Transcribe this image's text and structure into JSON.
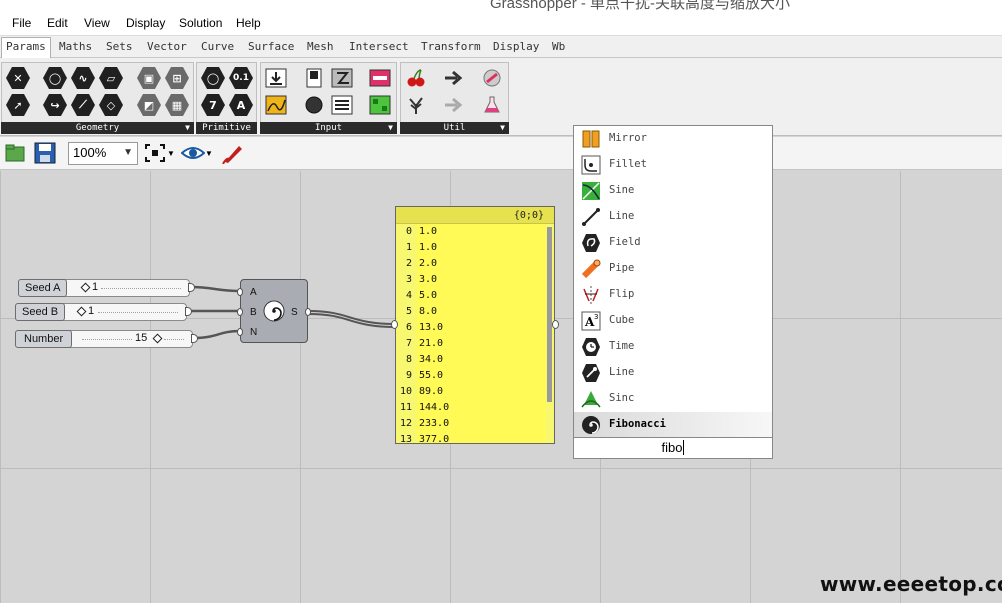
{
  "window": {
    "title": "Grasshopper - 单点干扰-关联高度与缩放大小"
  },
  "menu": [
    "File",
    "Edit",
    "View",
    "Display",
    "Solution",
    "Help"
  ],
  "tabs": [
    "Params",
    "Maths",
    "Sets",
    "Vector",
    "Curve",
    "Surface",
    "Mesh",
    "Intersect",
    "Transform",
    "Display",
    "Wb"
  ],
  "ribbon": {
    "panels": [
      "Geometry",
      "Primitive",
      "Input",
      "Util"
    ],
    "primitive_glyphs": [
      "0.1",
      "7",
      "A"
    ]
  },
  "toolbar": {
    "zoom": "100%"
  },
  "sliders": [
    {
      "name": "Seed A",
      "value": "1"
    },
    {
      "name": "Seed B",
      "value": "1"
    },
    {
      "name": "Number",
      "value": "15"
    }
  ],
  "fibonacci_component": {
    "inputs": [
      "A",
      "B",
      "N"
    ],
    "output": "S"
  },
  "panel": {
    "path": "{0;0}",
    "rows": [
      {
        "i": "0",
        "v": "1.0"
      },
      {
        "i": "1",
        "v": "1.0"
      },
      {
        "i": "2",
        "v": "2.0"
      },
      {
        "i": "3",
        "v": "3.0"
      },
      {
        "i": "4",
        "v": "5.0"
      },
      {
        "i": "5",
        "v": "8.0"
      },
      {
        "i": "6",
        "v": "13.0"
      },
      {
        "i": "7",
        "v": "21.0"
      },
      {
        "i": "8",
        "v": "34.0"
      },
      {
        "i": "9",
        "v": "55.0"
      },
      {
        "i": "10",
        "v": "89.0"
      },
      {
        "i": "11",
        "v": "144.0"
      },
      {
        "i": "12",
        "v": "233.0"
      },
      {
        "i": "13",
        "v": "377.0"
      }
    ]
  },
  "search": {
    "results": [
      {
        "label": "Mirror",
        "icon": "mirror-icon"
      },
      {
        "label": "Fillet",
        "icon": "fillet-icon"
      },
      {
        "label": "Sine",
        "icon": "sine-icon"
      },
      {
        "label": "Line",
        "icon": "line-icon"
      },
      {
        "label": "Field",
        "icon": "field-icon"
      },
      {
        "label": "Pipe",
        "icon": "pipe-icon"
      },
      {
        "label": "Flip",
        "icon": "flip-icon"
      },
      {
        "label": "Cube",
        "icon": "cube-icon"
      },
      {
        "label": "Time",
        "icon": "time-icon"
      },
      {
        "label": "Line",
        "icon": "line-sdl-icon"
      },
      {
        "label": "Sinc",
        "icon": "sinc-icon"
      },
      {
        "label": "Fibonacci",
        "icon": "fibonacci-icon"
      }
    ],
    "selected_index": 11,
    "query": "fibo"
  },
  "watermark": "www.eeeetop.com"
}
